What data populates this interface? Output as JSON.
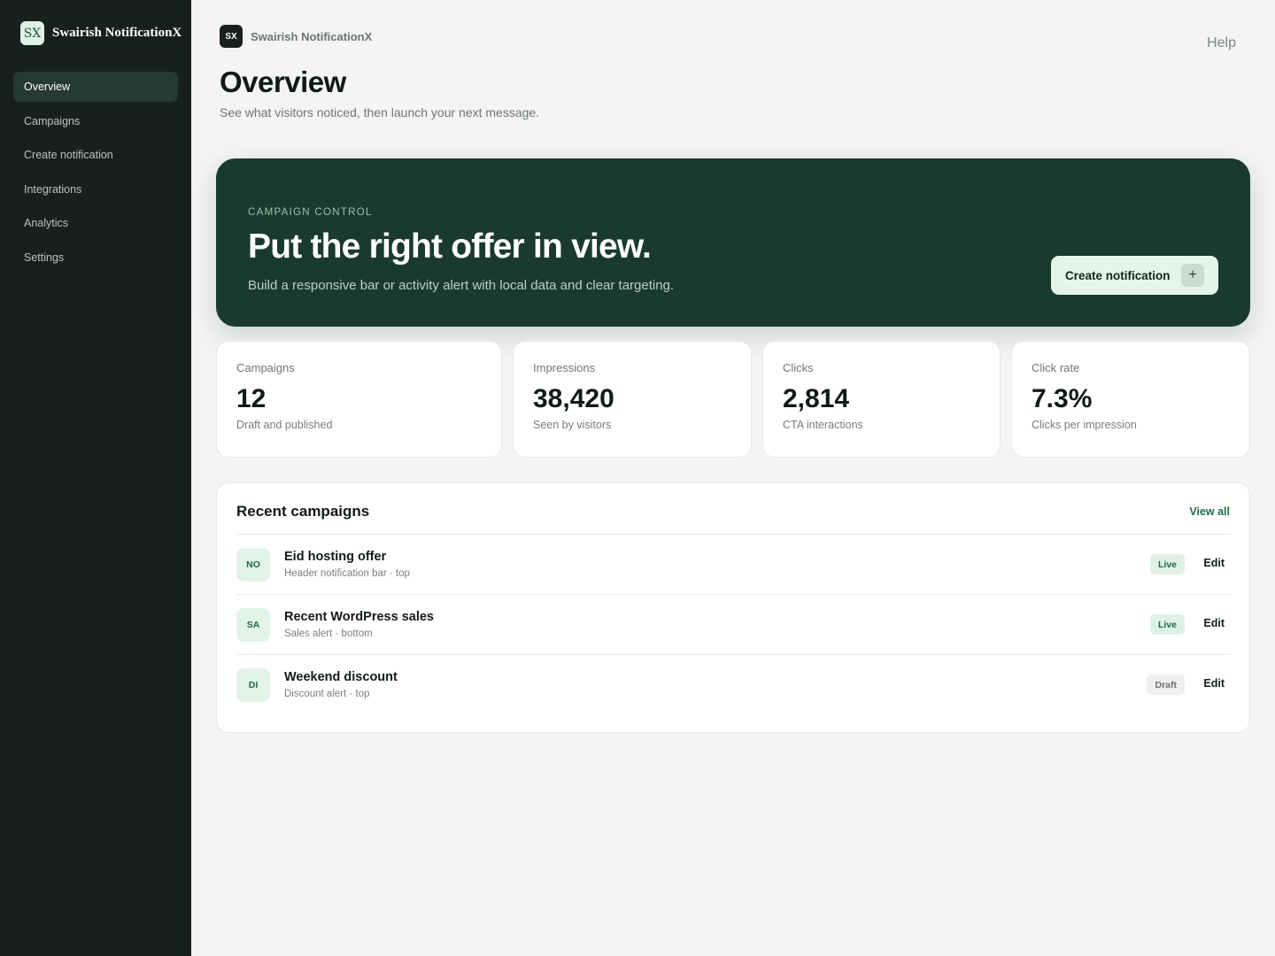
{
  "brand": {
    "logo": "SX",
    "name": "Swairish NotificationX"
  },
  "sidebar": {
    "items": [
      {
        "label": "Overview"
      },
      {
        "label": "Campaigns"
      },
      {
        "label": "Create notification"
      },
      {
        "label": "Integrations"
      },
      {
        "label": "Analytics"
      },
      {
        "label": "Settings"
      }
    ],
    "active_index": 0
  },
  "header": {
    "logo": "SX",
    "app_name": "Swairish NotificationX",
    "help_label": "Help",
    "title": "Overview",
    "subtitle": "See what visitors noticed, then launch your next message."
  },
  "hero": {
    "eyebrow": "CAMPAIGN CONTROL",
    "title": "Put the right offer in view.",
    "subtitle": "Build a responsive bar or activity alert with local data and clear targeting.",
    "button_label": "Create notification",
    "button_icon": "+"
  },
  "stats": [
    {
      "label": "Campaigns",
      "value": "12",
      "desc": "Draft and published"
    },
    {
      "label": "Impressions",
      "value": "38,420",
      "desc": "Seen by visitors"
    },
    {
      "label": "Clicks",
      "value": "2,814",
      "desc": "CTA interactions"
    },
    {
      "label": "Click rate",
      "value": "7.3%",
      "desc": "Clicks per impression"
    }
  ],
  "recent": {
    "title": "Recent campaigns",
    "view_all_label": "View all",
    "rows": [
      {
        "badge": "NO",
        "name": "Eid hosting offer",
        "meta": "Header notification bar · top",
        "status": "Live",
        "edit_label": "Edit"
      },
      {
        "badge": "SA",
        "name": "Recent WordPress sales",
        "meta": "Sales alert · bottom",
        "status": "Live",
        "edit_label": "Edit"
      },
      {
        "badge": "DI",
        "name": "Weekend discount",
        "meta": "Discount alert · top",
        "status": "Draft",
        "edit_label": "Edit"
      }
    ]
  },
  "colors": {
    "sidebar_bg": "#18201d",
    "hero_bg": "#1a3a2e",
    "accent": "#1f6b45",
    "live_badge_bg": "#dff1e6",
    "draft_badge_bg": "#eff0ef"
  }
}
